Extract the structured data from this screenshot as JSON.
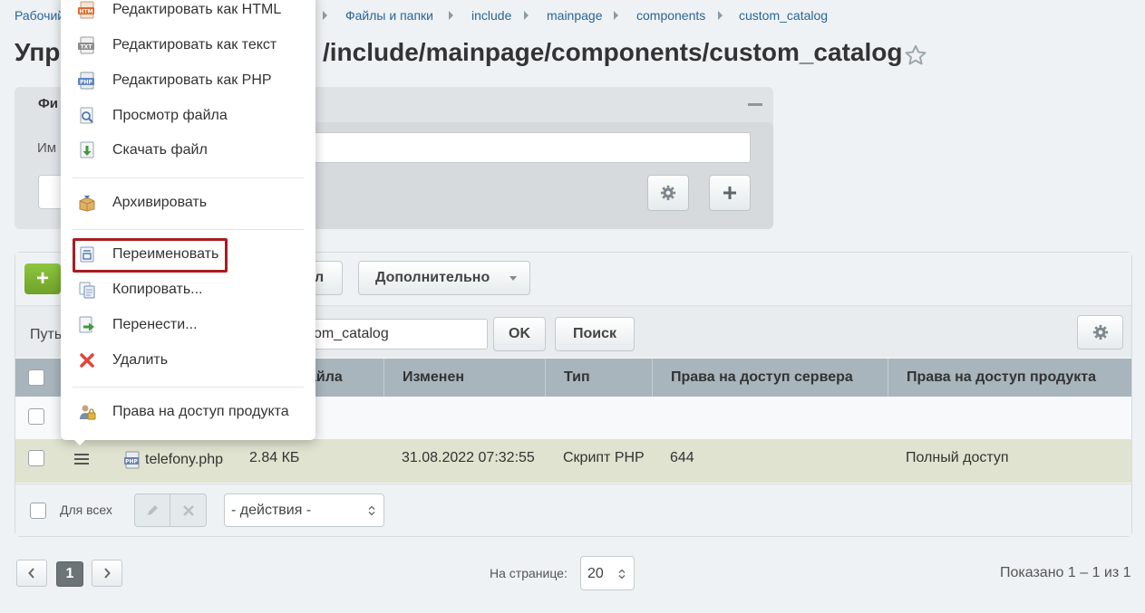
{
  "breadcrumb": {
    "home": "Рабочий",
    "files": "Файлы и папки",
    "include": "include",
    "mainpage": "mainpage",
    "components": "components",
    "custom_catalog": "custom_catalog"
  },
  "title": {
    "left": "Упр",
    "path": "/include/mainpage/components/custom_catalog"
  },
  "filter": {
    "heading": "Фи",
    "name_label": "Им"
  },
  "toolbar": {
    "add": "+",
    "button_stub": "л",
    "more": "Дополнительно"
  },
  "pathbar": {
    "label": "Путь",
    "value": "om_catalog",
    "ok": "OK",
    "search": "Поиск"
  },
  "table": {
    "columns": [
      "айла",
      "Изменен",
      "Тип",
      "Права на доступ сервера",
      "Права на доступ продукта"
    ],
    "rows": [
      {
        "name": "telefony.php",
        "size": "2.84 КБ",
        "modified": "31.08.2022 07:32:55",
        "type": "Скрипт PHP",
        "server_rights": "644",
        "product_rights": "Полный доступ"
      }
    ]
  },
  "footer": {
    "for_all": "Для всех",
    "actions": "- действия -"
  },
  "pager": {
    "current": "1",
    "per_page_label": "На странице:",
    "per_page": "20",
    "shown": "Показано 1 – 1 из 1"
  },
  "context_menu": {
    "items": [
      {
        "label": "Редактировать как HTML",
        "icon": "html-file-icon"
      },
      {
        "label": "Редактировать как текст",
        "icon": "txt-file-icon"
      },
      {
        "label": "Редактировать как PHP",
        "icon": "php-file-icon"
      },
      {
        "label": "Просмотр файла",
        "icon": "view-file-icon"
      },
      {
        "label": "Скачать файл",
        "icon": "download-file-icon"
      },
      {
        "label": "Архивировать",
        "icon": "archive-icon"
      },
      {
        "label": "Переименовать",
        "icon": "rename-icon"
      },
      {
        "label": "Копировать...",
        "icon": "copy-icon"
      },
      {
        "label": "Перенести...",
        "icon": "move-icon"
      },
      {
        "label": "Удалить",
        "icon": "delete-icon"
      },
      {
        "label": "Права на доступ продукта",
        "icon": "access-rights-icon"
      }
    ]
  },
  "colors": {
    "accent_green": "#7ab332",
    "highlight_red": "#a81c20",
    "link_blue": "#2a6496",
    "row_selected": "#dfe3cf"
  }
}
